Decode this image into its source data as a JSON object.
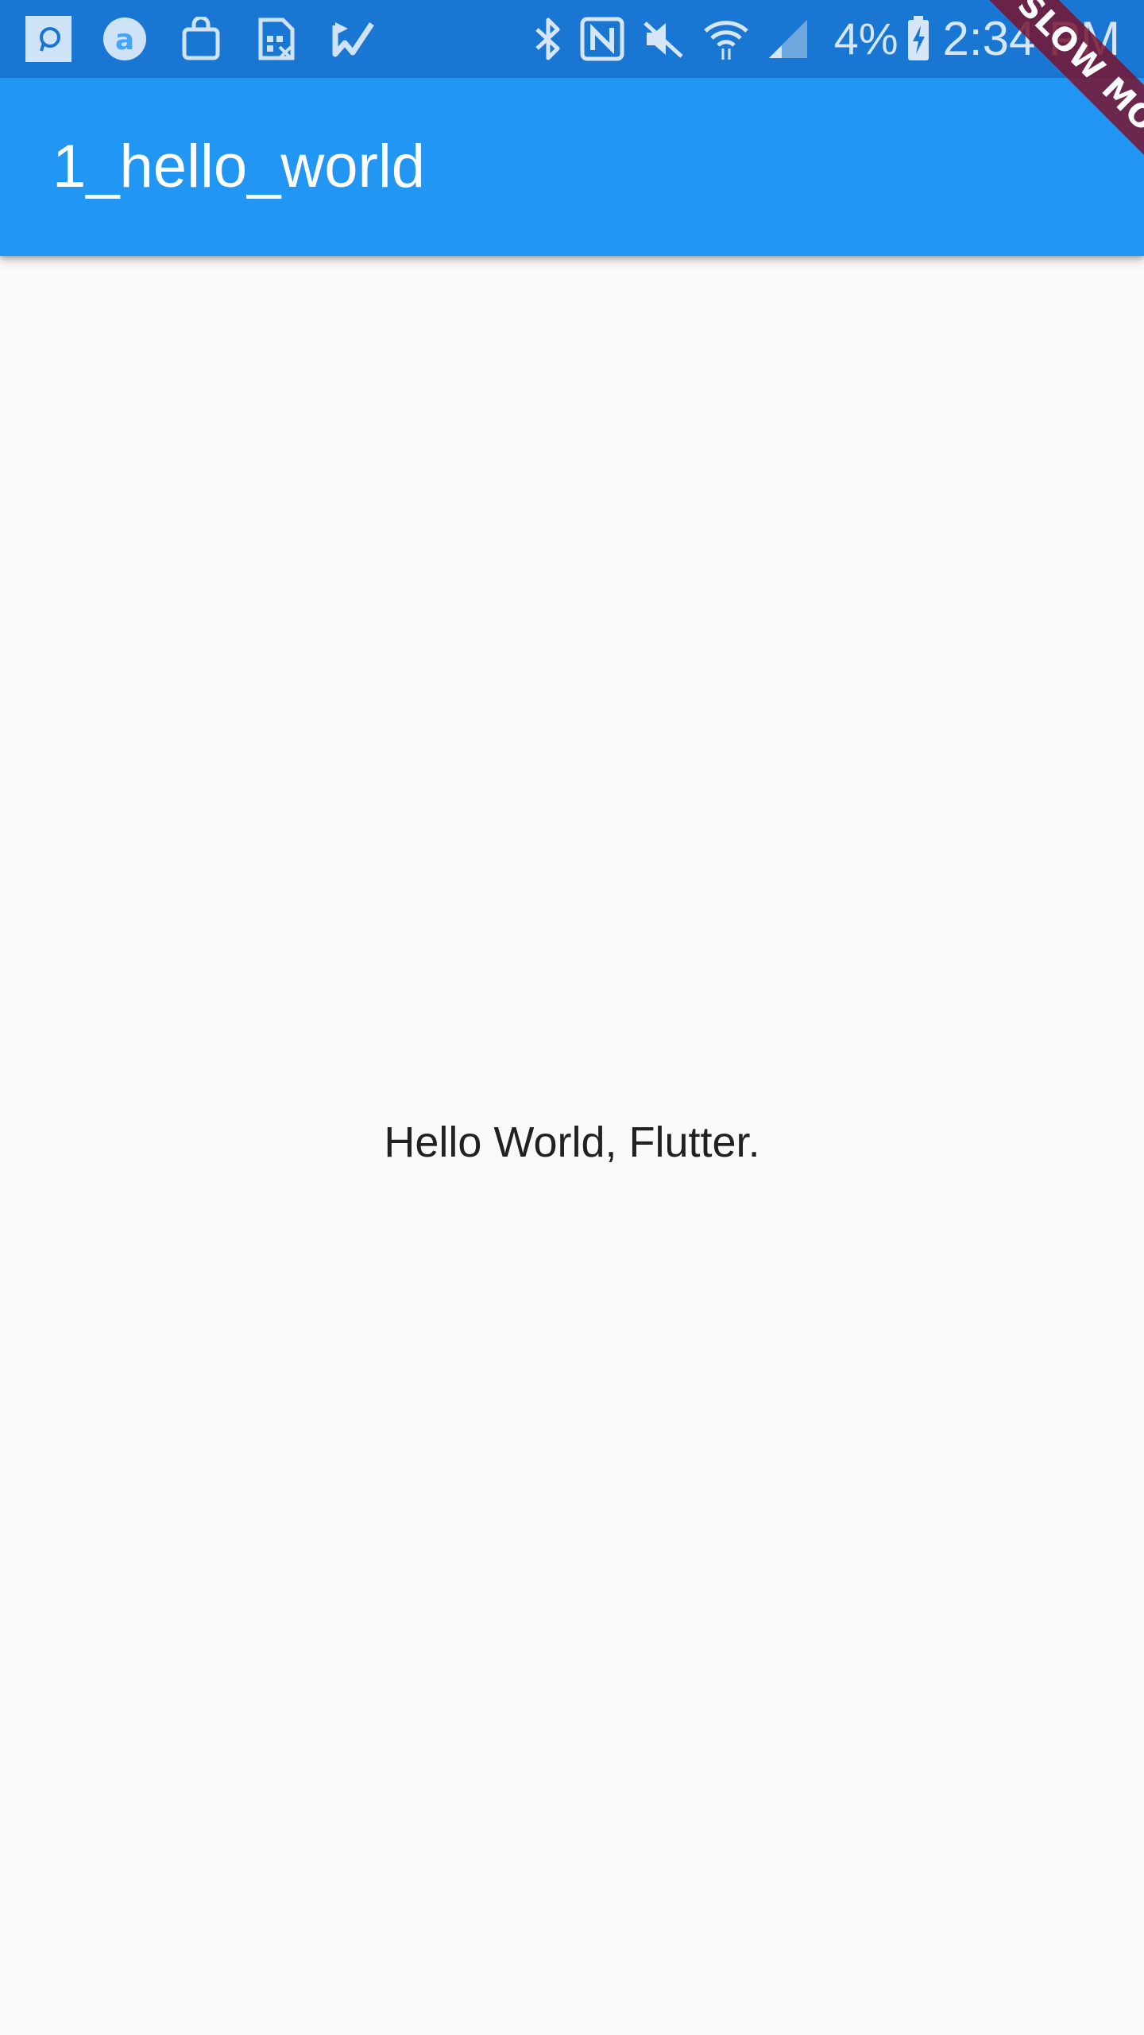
{
  "status_bar": {
    "left_icons": [
      "messages-app-icon",
      "browser-app-icon",
      "shopping-bag-icon",
      "sim-card-icon",
      "tasks-check-icon"
    ],
    "right_icons": [
      "bluetooth-icon",
      "nfc-icon",
      "mute-icon",
      "wifi-icon",
      "signal-icon"
    ],
    "battery_percent": "4%",
    "time": "2:34 PM",
    "colors": {
      "background": "#1976d2"
    }
  },
  "app_bar": {
    "title": "1_hello_world",
    "color": "#2196f3"
  },
  "body": {
    "text": "Hello World, Flutter."
  },
  "debug_banner": {
    "label": "SLOW MODE",
    "color": "#78142f"
  }
}
